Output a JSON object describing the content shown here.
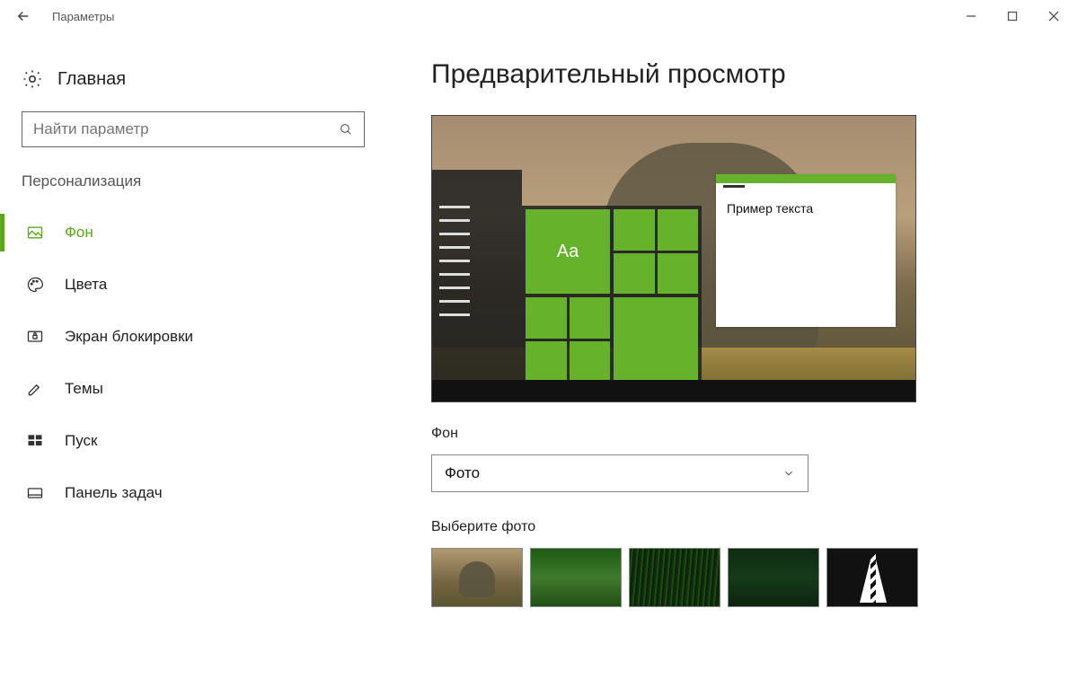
{
  "window": {
    "title": "Параметры"
  },
  "sidebar": {
    "home_label": "Главная",
    "search_placeholder": "Найти параметр",
    "section_label": "Персонализация",
    "items": [
      {
        "label": "Фон"
      },
      {
        "label": "Цвета"
      },
      {
        "label": "Экран блокировки"
      },
      {
        "label": "Темы"
      },
      {
        "label": "Пуск"
      },
      {
        "label": "Панель задач"
      }
    ]
  },
  "main": {
    "heading": "Предварительный просмотр",
    "preview_sample_text": "Пример текста",
    "preview_tile_aa": "Aa",
    "background_label": "Фон",
    "background_dropdown_value": "Фото",
    "choose_label": "Выберите фото"
  }
}
